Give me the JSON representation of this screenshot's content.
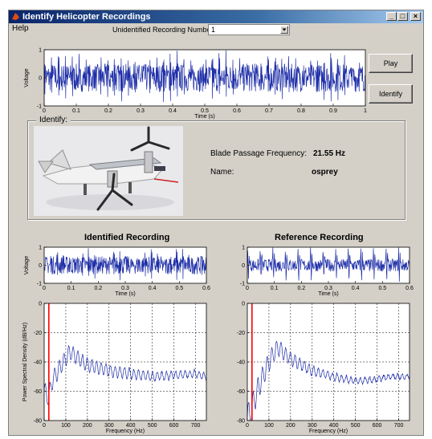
{
  "window": {
    "title": "Identify Helicopter Recordings",
    "buttons": {
      "minimize": "_",
      "maximize": "□",
      "close": "×"
    }
  },
  "menu": [
    "Help"
  ],
  "recording": {
    "label": "Unidentified Recording Number:",
    "value": "1"
  },
  "buttons": {
    "play": "Play",
    "identify": "Identify"
  },
  "identify_panel": {
    "title": "Identify:",
    "bpf_label": "Blade Passage Frequency:",
    "bpf_value": "21.55 Hz",
    "name_label": "Name:",
    "name_value": "osprey"
  },
  "headings": {
    "identified": "Identified Recording",
    "reference": "Reference Recording"
  },
  "colors": {
    "trace": "#1f2fa8",
    "marker": "#ff0000",
    "plot_bg": "#ffffff",
    "window_bg": "#d4d0c8"
  },
  "icons": {
    "window": "matlab-icon",
    "dropdown": "triangle-down-icon",
    "photo": "osprey-aircraft-photo"
  },
  "chart_data": [
    {
      "id": "main",
      "type": "line",
      "xlabel": "Time (s)",
      "ylabel": "Voltage",
      "xlim": [
        0,
        1
      ],
      "ylim": [
        -1,
        1
      ],
      "xticks": [
        "0",
        "0.1",
        "0.2",
        "0.3",
        "0.4",
        "0.5",
        "0.6",
        "0.7",
        "0.8",
        "0.9",
        "1"
      ],
      "yticks": [
        "1",
        "0",
        "-1"
      ],
      "grid": false,
      "waveform": {
        "pulses_per_second": 46,
        "noise_amplitude": 0.5,
        "pulse_amplitude": 0.9,
        "duration": 1
      }
    },
    {
      "id": "ident_time",
      "type": "line",
      "xlabel": "Time (s)",
      "ylabel": "Voltage",
      "xlim": [
        0,
        0.6
      ],
      "ylim": [
        -1,
        1
      ],
      "xticks": [
        "0",
        "0.1",
        "0.2",
        "0.3",
        "0.4",
        "0.5",
        "0.6"
      ],
      "yticks": [
        "1",
        "0",
        "-1"
      ],
      "grid": false,
      "waveform": {
        "pulses_per_second": 43,
        "noise_amplitude": 0.5,
        "pulse_amplitude": 0.85,
        "duration": 0.6
      }
    },
    {
      "id": "ref_time",
      "type": "line",
      "xlabel": "Time (s)",
      "ylabel": "",
      "xlim": [
        0,
        0.6
      ],
      "ylim": [
        -1,
        1
      ],
      "xticks": [
        "0",
        "0.1",
        "0.2",
        "0.3",
        "0.4",
        "0.5",
        "0.6"
      ],
      "yticks": [
        "1",
        "0",
        "-1"
      ],
      "grid": false,
      "waveform": {
        "pulses_per_second": 21.5,
        "noise_amplitude": 0.35,
        "pulse_amplitude": 1.0,
        "duration": 0.6
      }
    },
    {
      "id": "ident_psd",
      "type": "line",
      "xlabel": "Frequency (Hz)",
      "ylabel": "Power Spectral Density (dB/Hz)",
      "xlim": [
        0,
        750
      ],
      "ylim": [
        -80,
        0
      ],
      "xticks": [
        "0",
        "100",
        "200",
        "300",
        "400",
        "500",
        "600",
        "700"
      ],
      "yticks": [
        "0",
        "-20",
        "-40",
        "-60",
        "-80"
      ],
      "grid": true,
      "marker_x": 21.55,
      "psd": {
        "envelope": [
          [
            0,
            -60
          ],
          [
            20,
            -64
          ],
          [
            40,
            -52
          ],
          [
            80,
            -42
          ],
          [
            120,
            -33
          ],
          [
            160,
            -38
          ],
          [
            200,
            -42
          ],
          [
            250,
            -44
          ],
          [
            300,
            -46
          ],
          [
            400,
            -48
          ],
          [
            500,
            -50
          ],
          [
            600,
            -49
          ],
          [
            700,
            -48
          ],
          [
            750,
            -50
          ]
        ],
        "ripple_hz": 21.55,
        "ripple_db": 5,
        "ripple_decay_hz": 500
      }
    },
    {
      "id": "ref_psd",
      "type": "line",
      "xlabel": "Frequency (Hz)",
      "ylabel": "",
      "xlim": [
        0,
        750
      ],
      "ylim": [
        -80,
        0
      ],
      "xticks": [
        "0",
        "100",
        "200",
        "300",
        "400",
        "500",
        "600",
        "700"
      ],
      "yticks": [
        "0",
        "-20",
        "-40",
        "-60",
        "-80"
      ],
      "grid": true,
      "marker_x": 21.55,
      "psd": {
        "envelope": [
          [
            0,
            -78
          ],
          [
            20,
            -72
          ],
          [
            50,
            -58
          ],
          [
            100,
            -40
          ],
          [
            140,
            -30
          ],
          [
            200,
            -38
          ],
          [
            300,
            -46
          ],
          [
            400,
            -50
          ],
          [
            500,
            -53
          ],
          [
            600,
            -52
          ],
          [
            650,
            -50
          ],
          [
            750,
            -50
          ]
        ],
        "ripple_hz": 21.55,
        "ripple_db": 8,
        "ripple_decay_hz": 220
      }
    }
  ]
}
